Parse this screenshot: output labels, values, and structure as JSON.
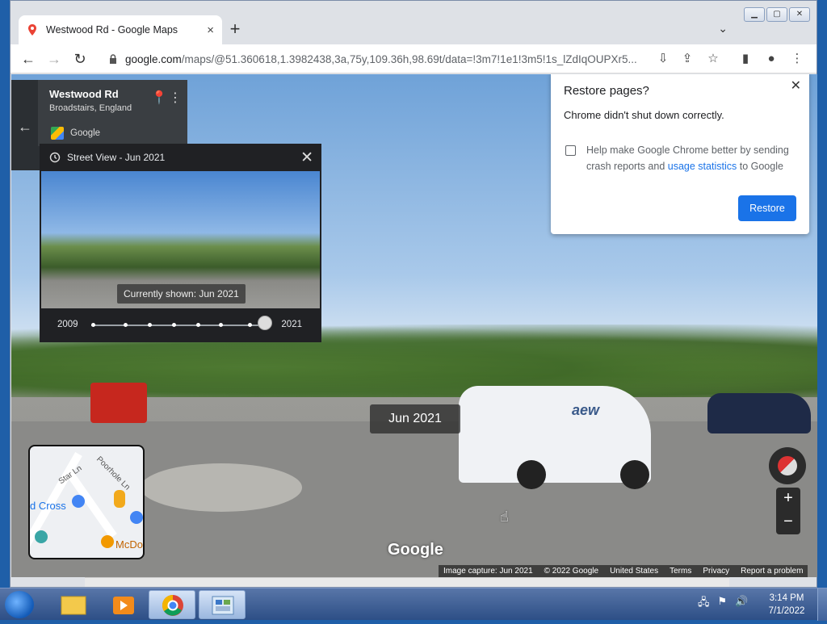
{
  "browser": {
    "tab_title": "Westwood Rd - Google Maps",
    "url_domain": "google.com",
    "url_path": "/maps/@51.360618,1.3982438,3a,75y,109.36h,98.69t/data=!3m7!1e1!3m5!1s_lZdIqOUPXr5...",
    "new_tab": "+",
    "close_tab": "×"
  },
  "place": {
    "title": "Westwood Rd",
    "subtitle": "Broadstairs, England",
    "provider": "Google"
  },
  "street_view_panel": {
    "header": "Street View - Jun 2021",
    "tooltip": "Currently shown: Jun 2021",
    "year_start": "2009",
    "year_end": "2021",
    "selected_fraction": 1.0
  },
  "date_badge": "Jun 2021",
  "van_text": "aew",
  "minimap": {
    "street_label_1": "Star Ln",
    "street_label_2": "Poorhole Ln",
    "place_label_1": "d Cross",
    "place_label_2": "McDo"
  },
  "google_watermark": "Google",
  "footer": {
    "capture": "Image capture: Jun 2021",
    "copyright": "© 2022 Google",
    "region": "United States",
    "terms": "Terms",
    "privacy": "Privacy",
    "report": "Report a problem"
  },
  "restore_dialog": {
    "title": "Restore pages?",
    "message": "Chrome didn't shut down correctly.",
    "checkbox_text_a": "Help make Google Chrome better by sending crash reports and",
    "checkbox_link": "usage statistics",
    "checkbox_text_b": "to Google",
    "button": "Restore"
  },
  "taskbar": {
    "time": "3:14 PM",
    "date": "7/1/2022"
  },
  "colors": {
    "accent_blue": "#1a73e8",
    "panel_dark": "#202124"
  }
}
